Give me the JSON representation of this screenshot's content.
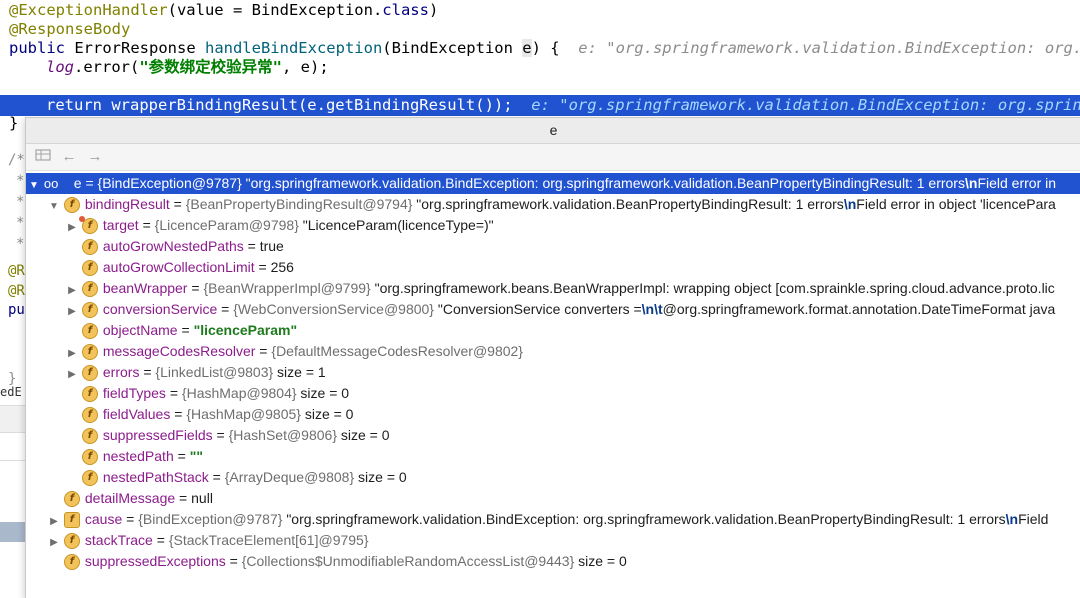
{
  "editor": {
    "line1": {
      "annotation": "@ExceptionHandler",
      "args": "(value = BindException.",
      "kw": "class",
      "close": ")"
    },
    "line2": {
      "annotation": "@ResponseBody"
    },
    "line3": {
      "kw": "public",
      "type": " ErrorResponse ",
      "method": "handleBindException",
      "params": "(BindException ",
      "param": "e",
      "tail": ") {  ",
      "hint": "e: \"org.springframework.validation.BindException: org."
    },
    "line4": {
      "field": "log",
      "call": ".error(",
      "string": "\"参数绑定校验异常\"",
      "tail": ", e);"
    },
    "line5": {
      "code": "return wrapperBindingResult(e.getBindingResult());",
      "hint": "e: \"org.springframework.validation.BindException: org.sprin"
    },
    "line6": {
      "code": "}"
    },
    "fragments": [
      "/*",
      "*",
      "*",
      "*",
      "*",
      "@R",
      "@R",
      "pu",
      "}",
      "edE"
    ]
  },
  "popup": {
    "title": "e",
    "toolbar": {
      "back_icon": "back-arrow-icon",
      "forward_icon": "forward-arrow-icon"
    }
  },
  "tree": [
    {
      "name": "e",
      "eq": " = ",
      "ref": "{BindException@9787}",
      "value": " \"org.springframework.validation.BindException: org.springframework.validation.BeanPropertyBindingResult: 1 errors",
      "esc": "\\n",
      "value2": "Field error in"
    },
    {
      "name": "bindingResult",
      "eq": " = ",
      "ref": "{BeanPropertyBindingResult@9794}",
      "value": " \"org.springframework.validation.BeanPropertyBindingResult: 1 errors",
      "esc": "\\n",
      "value2": "Field error in object 'licencePara"
    },
    {
      "name": "target",
      "eq": " = ",
      "ref": "{LicenceParam@9798}",
      "value": " \"LicenceParam(licenceType=)\""
    },
    {
      "name": "autoGrowNestedPaths",
      "eq": " = ",
      "value": "true"
    },
    {
      "name": "autoGrowCollectionLimit",
      "eq": " = ",
      "value": "256"
    },
    {
      "name": "beanWrapper",
      "eq": " = ",
      "ref": "{BeanWrapperImpl@9799}",
      "value": " \"org.springframework.beans.BeanWrapperImpl: wrapping object [com.sprainkle.spring.cloud.advance.proto.lic"
    },
    {
      "name": "conversionService",
      "eq": " = ",
      "ref": "{WebConversionService@9800}",
      "value": " \"ConversionService converters =",
      "esc": "\\n\\t",
      "value2": "@org.springframework.format.annotation.DateTimeFormat java"
    },
    {
      "name": "objectName",
      "eq": " = ",
      "str": "\"licenceParam\""
    },
    {
      "name": "messageCodesResolver",
      "eq": " = ",
      "ref": "{DefaultMessageCodesResolver@9802}"
    },
    {
      "name": "errors",
      "eq": " = ",
      "ref": "{LinkedList@9803}",
      "value": "  size = 1"
    },
    {
      "name": "fieldTypes",
      "eq": " = ",
      "ref": "{HashMap@9804}",
      "value": "  size = 0"
    },
    {
      "name": "fieldValues",
      "eq": " = ",
      "ref": "{HashMap@9805}",
      "value": "  size = 0"
    },
    {
      "name": "suppressedFields",
      "eq": " = ",
      "ref": "{HashSet@9806}",
      "value": "  size = 0"
    },
    {
      "name": "nestedPath",
      "eq": " = ",
      "str": "\"\""
    },
    {
      "name": "nestedPathStack",
      "eq": " = ",
      "ref": "{ArrayDeque@9808}",
      "value": "  size = 0"
    },
    {
      "name": "detailMessage",
      "eq": " = ",
      "value": "null"
    },
    {
      "name": "cause",
      "eq": " = ",
      "ref": "{BindException@9787}",
      "value": " \"org.springframework.validation.BindException: org.springframework.validation.BeanPropertyBindingResult: 1 errors",
      "esc": "\\n",
      "value2": "Field"
    },
    {
      "name": "stackTrace",
      "eq": " = ",
      "ref": "{StackTraceElement[61]@9795}"
    },
    {
      "name": "suppressedExceptions",
      "eq": " = ",
      "ref": "{Collections$UnmodifiableRandomAccessList@9443}",
      "value": "  size = 0"
    }
  ],
  "colors": {
    "selection": "#2152d0",
    "field_badge": "#f2c35b",
    "field_name": "#8c1c8c"
  }
}
